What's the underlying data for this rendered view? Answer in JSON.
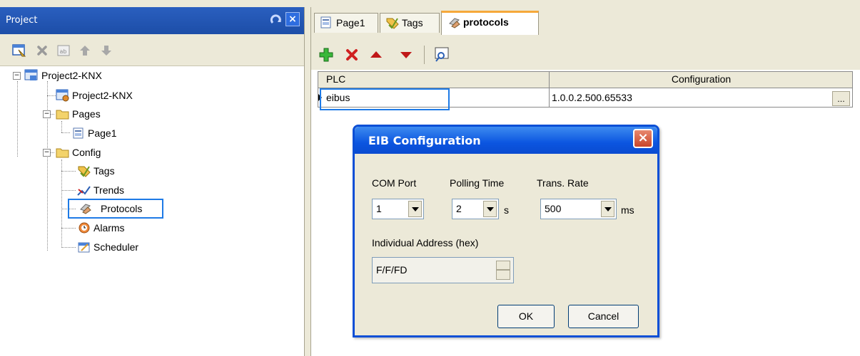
{
  "project_panel": {
    "title": "Project",
    "toolbar_icons": [
      "properties-icon",
      "delete-icon",
      "rename-icon",
      "move-up-icon",
      "move-down-icon"
    ],
    "tree": {
      "root": "Project2-KNX",
      "project_item": "Project2-KNX",
      "pages": "Pages",
      "page1": "Page1",
      "config": "Config",
      "tags": "Tags",
      "trends": "Trends",
      "protocols": "Protocols",
      "alarms": "Alarms",
      "scheduler": "Scheduler"
    },
    "selected": "Protocols"
  },
  "tabs": [
    {
      "label": "Page1",
      "icon": "page-icon"
    },
    {
      "label": "Tags",
      "icon": "tags-icon"
    },
    {
      "label": "protocols",
      "icon": "protocols-icon",
      "active": true
    }
  ],
  "grid_toolbar_icons": [
    "add-icon",
    "remove-icon",
    "move-up-icon",
    "move-down-icon",
    "preview-icon"
  ],
  "grid": {
    "columns": [
      "PLC",
      "Configuration"
    ],
    "rows": [
      {
        "plc": "eibus",
        "configuration": "1.0.0.2.500.65533",
        "browse": "..."
      }
    ]
  },
  "dialog": {
    "title": "EIB Configuration",
    "com_port_label": "COM Port",
    "com_port_value": "1",
    "polling_time_label": "Polling Time",
    "polling_time_value": "2",
    "polling_unit": "s",
    "trans_rate_label": "Trans. Rate",
    "trans_rate_value": "500",
    "trans_rate_unit": "ms",
    "individual_address_label": "Individual Address (hex)",
    "individual_address_value": "F/F/FD",
    "ok_label": "OK",
    "cancel_label": "Cancel"
  },
  "colors": {
    "title_bar": "#1d4ea8",
    "dialog_title": "#0b55e0",
    "highlight": "#1e7ae6",
    "active_tab_accent": "#f6a83a"
  }
}
